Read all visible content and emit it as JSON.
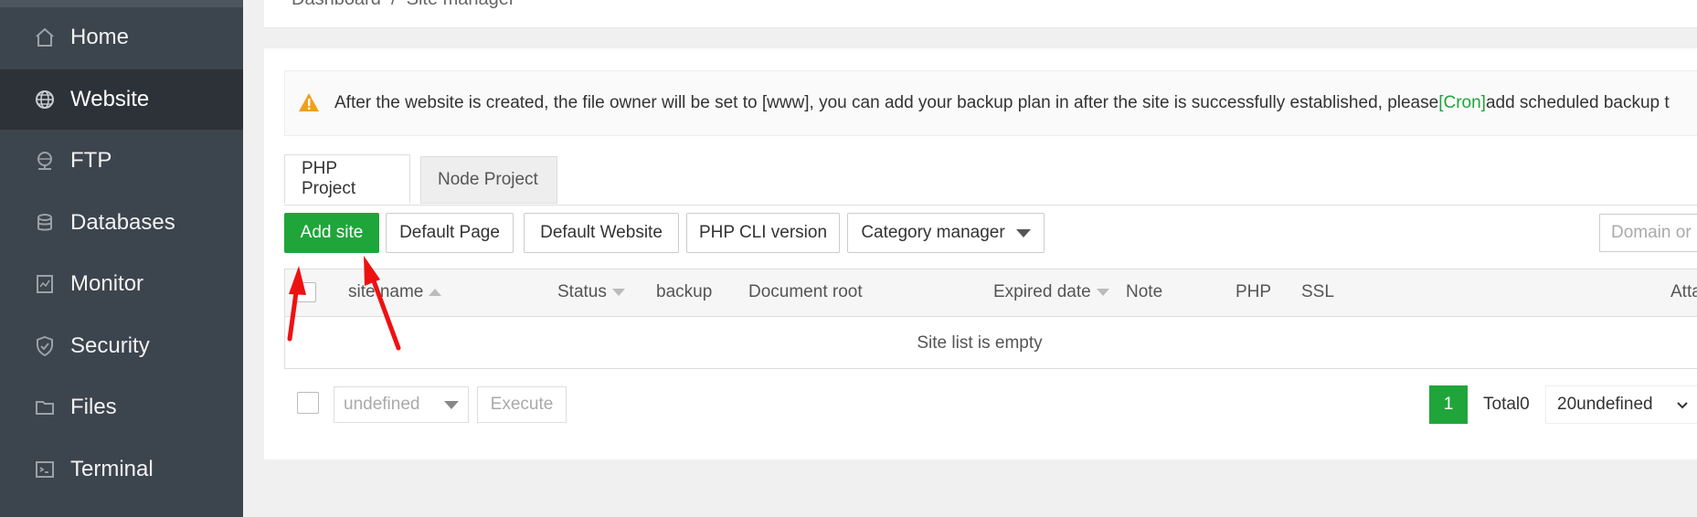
{
  "sidebar": {
    "items": [
      {
        "label": "Home",
        "icon": "home-icon"
      },
      {
        "label": "Website",
        "icon": "globe-icon",
        "active": true
      },
      {
        "label": "FTP",
        "icon": "ftp-icon"
      },
      {
        "label": "Databases",
        "icon": "database-icon"
      },
      {
        "label": "Monitor",
        "icon": "monitor-icon"
      },
      {
        "label": "Security",
        "icon": "shield-icon"
      },
      {
        "label": "Files",
        "icon": "folder-icon"
      },
      {
        "label": "Terminal",
        "icon": "terminal-icon"
      }
    ]
  },
  "breadcrumb": {
    "text": "Dashboard  /  Site manager"
  },
  "notice": {
    "before": "After the website is created, the file owner will be set to [www], you can add your backup plan in after the site is successfully established, please",
    "link": "[Cron]",
    "after": "add scheduled backup t"
  },
  "tabs": [
    {
      "label": "PHP Project",
      "active": true
    },
    {
      "label": "Node Project",
      "active": false
    }
  ],
  "toolbar": {
    "add_site": "Add site",
    "default_page": "Default Page",
    "default_website": "Default Website",
    "php_cli": "PHP CLI version",
    "category_manager": "Category manager",
    "search_placeholder": "Domain or"
  },
  "table": {
    "columns": [
      "site name",
      "Status",
      "backup",
      "Document root",
      "Expired date",
      "Note",
      "PHP",
      "SSL",
      "Atta"
    ],
    "empty_text": "Site list is empty"
  },
  "footer": {
    "batch_select": "undefined",
    "execute": "Execute",
    "current_page": "1",
    "total": "Total0",
    "page_size": "20undefined"
  },
  "colors": {
    "sidebar_bg": "#3c444d",
    "sidebar_active": "#2c3238",
    "accent_green": "#20a53a",
    "annotation_red": "#ee1111"
  }
}
